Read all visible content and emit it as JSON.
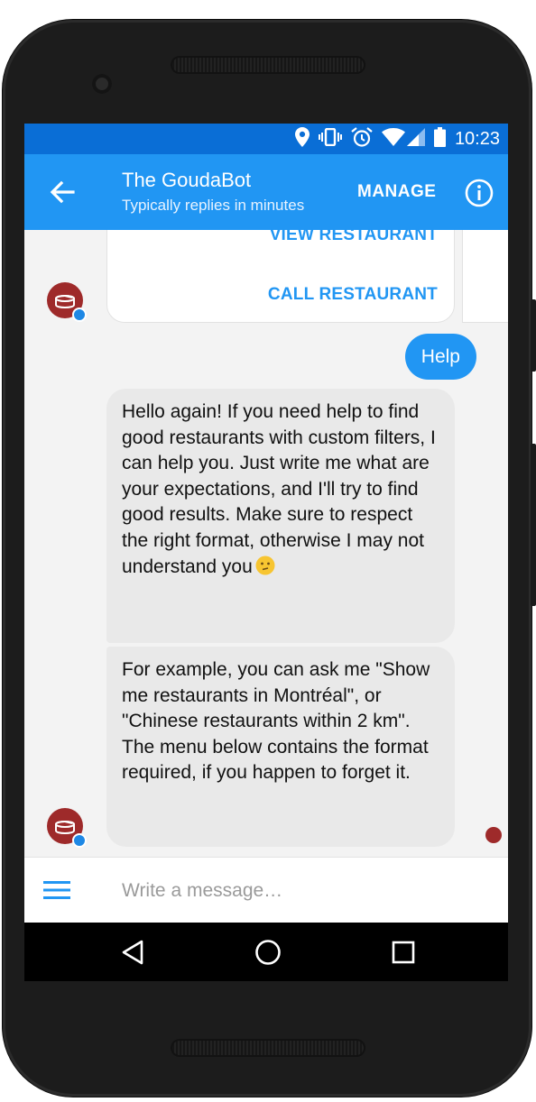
{
  "status_bar": {
    "time": "10:23",
    "icons": [
      "location-icon",
      "vibrate-icon",
      "alarm-icon",
      "wifi-icon",
      "signal-icon",
      "battery-icon"
    ]
  },
  "header": {
    "title": "The GoudaBot",
    "subtitle": "Typically replies in minutes",
    "manage_label": "MANAGE",
    "icons": [
      "back-arrow-icon",
      "info-icon"
    ]
  },
  "chat": {
    "card_buttons": [
      "VIEW RESTAURANT",
      "CALL RESTAURANT"
    ],
    "user_message": "Help",
    "bot_message_1": "Hello again! If you need help to find good restaurants with custom filters, I can help you. Just write me what are your expectations, and I'll try to find good results. Make sure to respect the right format, otherwise I may not understand you",
    "bot_message_1_emoji": "confused-face-icon",
    "bot_message_2": "For example, you can ask me \"Show me restaurants in Montréal\", or \"Chinese restaurants within 2 km\". The menu below contains the format required, if you happen to forget it."
  },
  "composer": {
    "placeholder": "Write a message…",
    "menu_icon": "hamburger-menu-icon"
  },
  "nav_bar": {
    "icons": [
      "back-triangle-icon",
      "home-circle-icon",
      "recents-square-icon"
    ]
  },
  "colors": {
    "status_bar": "#0a6ed6",
    "app_bar": "#2196f3",
    "accent": "#2196f3",
    "bot_bubble": "#e9e9e9",
    "avatar": "#9e2a2a"
  }
}
